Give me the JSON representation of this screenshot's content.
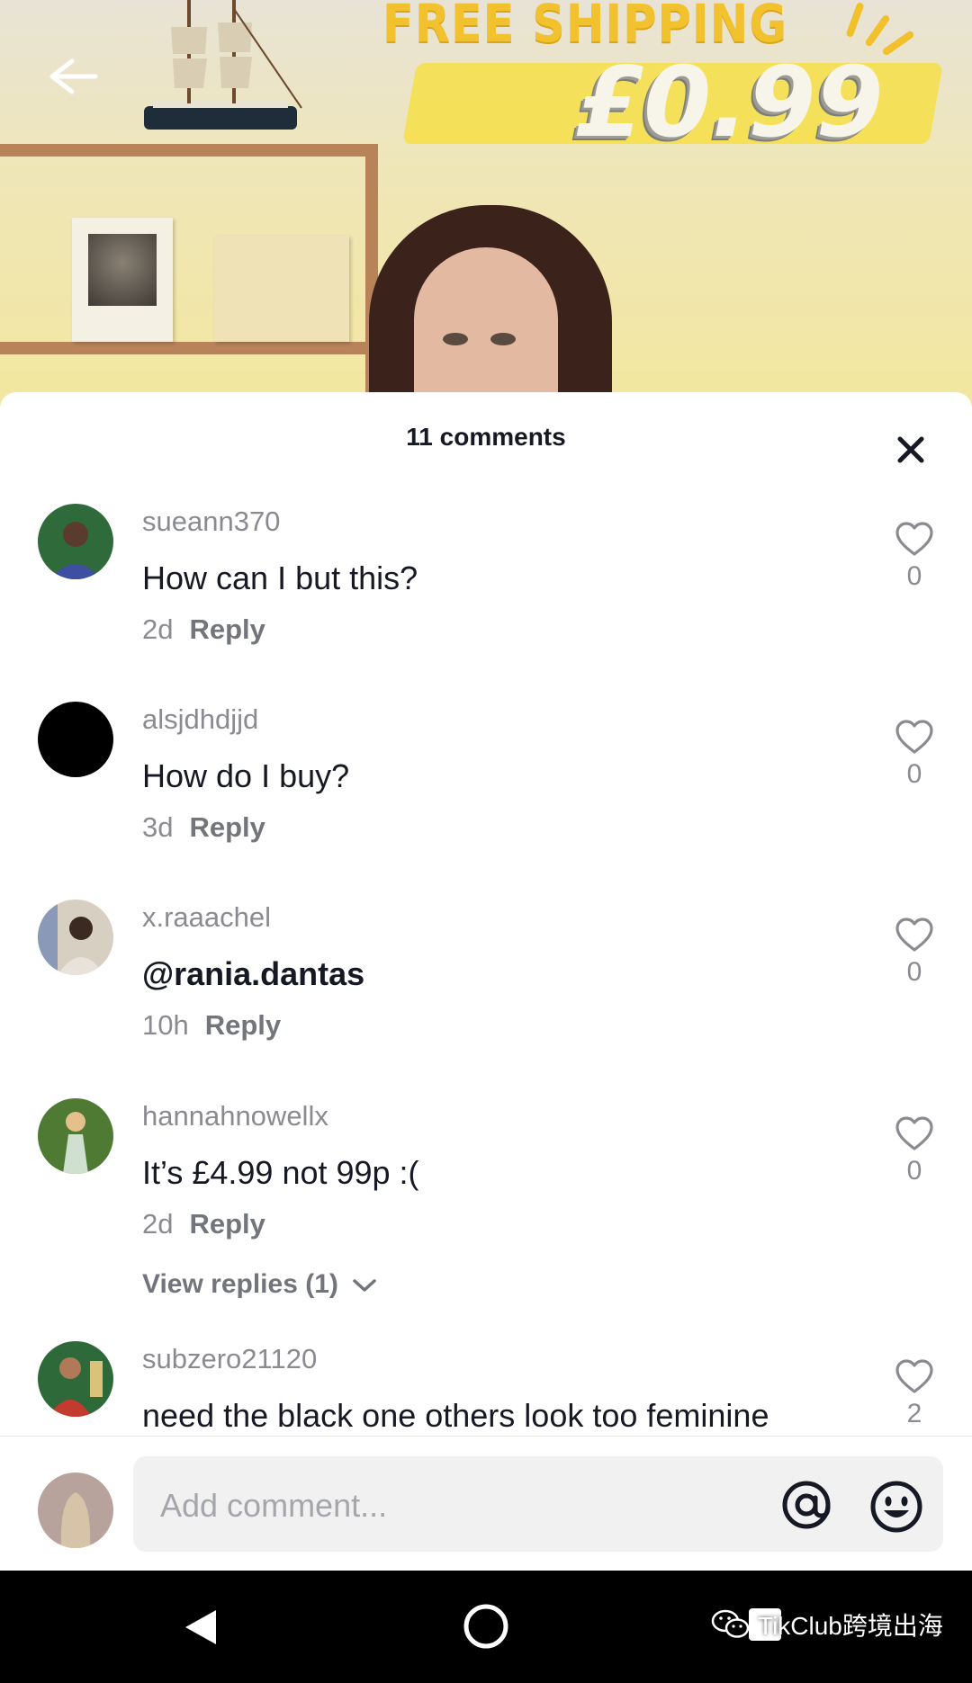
{
  "video": {
    "promo_title": "FREE SHIPPING",
    "promo_price": "£0.99"
  },
  "comments_sheet": {
    "title": "11 comments",
    "reply_label": "Reply",
    "comments": [
      {
        "username": "sueann370",
        "text": "How can I but this?",
        "time": "2d",
        "likes": "0",
        "avatar_color": "#2f6b3a"
      },
      {
        "username": "alsjdhdjjd",
        "text": "How do I buy?",
        "time": "3d",
        "likes": "0",
        "avatar_color": "#000000"
      },
      {
        "username": "x.raaachel",
        "text": "@rania.dantas",
        "time": "10h",
        "likes": "0",
        "avatar_color": "#c9b9a4"
      },
      {
        "username": "hannahnowellx",
        "text": "It’s £4.99 not 99p :(",
        "time": "2d",
        "likes": "0",
        "avatar_color": "#4f7a34",
        "view_replies": "View replies (1)"
      },
      {
        "username": "subzero21120",
        "text": "need the black one others look too feminine",
        "likes": "2",
        "avatar_color": "#9d3a30"
      }
    ]
  },
  "composer": {
    "placeholder": "Add comment...",
    "avatar_color": "#b7a39b"
  },
  "watermark": "TikClub跨境出海",
  "icons": [
    "back-arrow-icon",
    "close-icon",
    "heart-icon",
    "chevron-down-icon",
    "at-icon",
    "emoji-icon",
    "nav-back-icon",
    "nav-home-icon",
    "nav-recents-icon",
    "wechat-icon"
  ]
}
